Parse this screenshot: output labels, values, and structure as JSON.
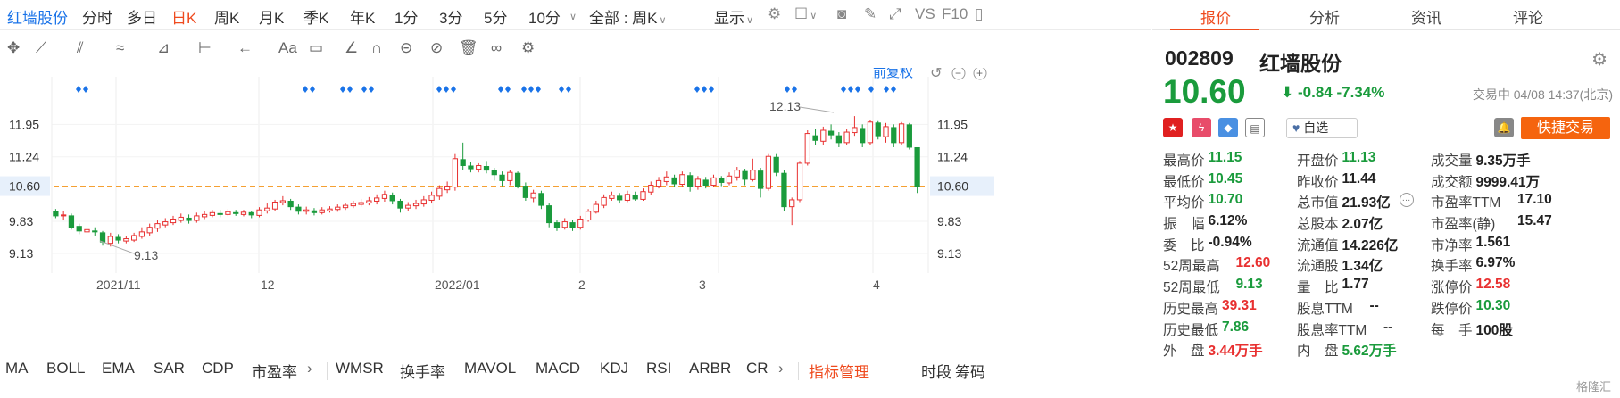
{
  "toolbar": {
    "stock_name": "红墙股份",
    "periods": [
      "分时",
      "多日",
      "日K",
      "周K",
      "月K",
      "季K",
      "年K",
      "1分",
      "3分",
      "5分",
      "10分"
    ],
    "active_period": "日K",
    "range_select": "全部 : 周K",
    "display_label": "显示",
    "vs_label": "VS",
    "f10_label": "F10"
  },
  "chart": {
    "adjust_label": "前复权",
    "high_label": "12.13",
    "low_label": "9.13",
    "y_ticks": [
      "11.95",
      "11.24",
      "10.60",
      "9.83",
      "9.13"
    ],
    "current_price_tag": "10.60",
    "x_labels": [
      "2021/11",
      "12",
      "2022/01",
      "2",
      "3",
      "4"
    ]
  },
  "chart_data": {
    "type": "candlestick",
    "ylim": [
      8.7,
      12.6
    ],
    "reference_line": 10.6,
    "candles": [
      [
        10.05,
        9.95,
        10.1,
        9.9
      ],
      [
        9.95,
        9.97,
        10.05,
        9.85
      ],
      [
        9.95,
        9.7,
        10.0,
        9.65
      ],
      [
        9.72,
        9.62,
        9.78,
        9.55
      ],
      [
        9.6,
        9.65,
        9.75,
        9.5
      ],
      [
        9.62,
        9.6,
        9.7,
        9.52
      ],
      [
        9.58,
        9.38,
        9.62,
        9.3
      ],
      [
        9.35,
        9.5,
        9.58,
        9.28
      ],
      [
        9.48,
        9.42,
        9.55,
        9.35
      ],
      [
        9.4,
        9.45,
        9.5,
        9.35
      ],
      [
        9.42,
        9.52,
        9.58,
        9.38
      ],
      [
        9.5,
        9.6,
        9.7,
        9.45
      ],
      [
        9.58,
        9.7,
        9.78,
        9.52
      ],
      [
        9.68,
        9.78,
        9.85,
        9.6
      ],
      [
        9.75,
        9.82,
        9.9,
        9.7
      ],
      [
        9.8,
        9.88,
        9.95,
        9.75
      ],
      [
        9.85,
        9.92,
        10.0,
        9.8
      ],
      [
        9.9,
        9.85,
        9.98,
        9.78
      ],
      [
        9.85,
        9.95,
        10.02,
        9.8
      ],
      [
        9.93,
        9.98,
        10.05,
        9.88
      ],
      [
        9.96,
        10.02,
        10.08,
        9.92
      ],
      [
        10.0,
        9.98,
        10.08,
        9.92
      ],
      [
        9.98,
        10.04,
        10.1,
        9.94
      ],
      [
        10.02,
        10.0,
        10.08,
        9.95
      ],
      [
        9.98,
        10.03,
        10.08,
        9.94
      ],
      [
        10.02,
        9.97,
        10.06,
        9.9
      ],
      [
        9.96,
        10.08,
        10.14,
        9.92
      ],
      [
        10.06,
        10.12,
        10.22,
        10.0
      ],
      [
        10.1,
        10.25,
        10.3,
        10.05
      ],
      [
        10.24,
        10.28,
        10.38,
        10.18
      ],
      [
        10.27,
        10.15,
        10.32,
        10.08
      ],
      [
        10.14,
        10.05,
        10.2,
        9.98
      ],
      [
        10.05,
        10.08,
        10.15,
        9.98
      ],
      [
        10.06,
        10.02,
        10.12,
        9.96
      ],
      [
        10.02,
        10.08,
        10.14,
        9.98
      ],
      [
        10.06,
        10.1,
        10.16,
        10.02
      ],
      [
        10.09,
        10.14,
        10.2,
        10.04
      ],
      [
        10.13,
        10.18,
        10.24,
        10.08
      ],
      [
        10.17,
        10.22,
        10.28,
        10.12
      ],
      [
        10.2,
        10.24,
        10.32,
        10.15
      ],
      [
        10.23,
        10.28,
        10.36,
        10.18
      ],
      [
        10.27,
        10.34,
        10.42,
        10.2
      ],
      [
        10.33,
        10.42,
        10.5,
        10.26
      ],
      [
        10.4,
        10.28,
        10.46,
        10.2
      ],
      [
        10.27,
        10.12,
        10.32,
        10.02
      ],
      [
        10.12,
        10.18,
        10.25,
        10.05
      ],
      [
        10.17,
        10.22,
        10.3,
        10.1
      ],
      [
        10.21,
        10.3,
        10.38,
        10.15
      ],
      [
        10.29,
        10.4,
        10.48,
        10.22
      ],
      [
        10.38,
        10.55,
        10.62,
        10.3
      ],
      [
        10.52,
        10.6,
        10.7,
        10.45
      ],
      [
        10.58,
        11.2,
        11.3,
        10.5
      ],
      [
        11.18,
        11.05,
        11.55,
        10.95
      ],
      [
        11.04,
        10.98,
        11.12,
        10.9
      ],
      [
        10.97,
        11.05,
        11.1,
        10.9
      ],
      [
        11.03,
        10.95,
        11.15,
        10.88
      ],
      [
        10.94,
        10.85,
        11.0,
        10.72
      ],
      [
        10.84,
        10.72,
        10.92,
        10.6
      ],
      [
        10.72,
        10.9,
        10.95,
        10.62
      ],
      [
        10.88,
        10.6,
        10.92,
        10.55
      ],
      [
        10.6,
        10.35,
        10.68,
        10.28
      ],
      [
        10.34,
        10.45,
        10.52,
        10.25
      ],
      [
        10.44,
        10.18,
        10.5,
        10.1
      ],
      [
        10.17,
        9.8,
        10.22,
        9.7
      ],
      [
        9.8,
        9.7,
        9.85,
        9.62
      ],
      [
        9.7,
        9.82,
        9.9,
        9.65
      ],
      [
        9.8,
        9.7,
        9.86,
        9.62
      ],
      [
        9.7,
        9.88,
        9.95,
        9.65
      ],
      [
        9.86,
        10.05,
        10.1,
        9.82
      ],
      [
        10.03,
        10.2,
        10.28,
        10.0
      ],
      [
        10.18,
        10.35,
        10.42,
        10.12
      ],
      [
        10.33,
        10.4,
        10.48,
        10.28
      ],
      [
        10.38,
        10.3,
        10.45,
        10.22
      ],
      [
        10.29,
        10.42,
        10.5,
        10.25
      ],
      [
        10.4,
        10.32,
        10.48,
        10.28
      ],
      [
        10.31,
        10.48,
        10.55,
        10.28
      ],
      [
        10.47,
        10.62,
        10.7,
        10.4
      ],
      [
        10.6,
        10.72,
        10.8,
        10.55
      ],
      [
        10.7,
        10.8,
        10.92,
        10.62
      ],
      [
        10.78,
        10.65,
        10.85,
        10.58
      ],
      [
        10.64,
        10.85,
        10.92,
        10.58
      ],
      [
        10.83,
        10.6,
        10.9,
        10.48
      ],
      [
        10.6,
        10.75,
        10.82,
        10.52
      ],
      [
        10.73,
        10.62,
        10.8,
        10.55
      ],
      [
        10.62,
        10.78,
        10.85,
        10.58
      ],
      [
        10.76,
        10.68,
        10.82,
        10.6
      ],
      [
        10.67,
        10.82,
        10.9,
        10.62
      ],
      [
        10.8,
        10.95,
        11.02,
        10.72
      ],
      [
        10.92,
        10.75,
        10.98,
        10.62
      ],
      [
        10.74,
        10.95,
        11.2,
        10.7
      ],
      [
        10.93,
        10.55,
        11.0,
        10.35
      ],
      [
        10.55,
        11.25,
        11.3,
        10.5
      ],
      [
        11.23,
        10.9,
        11.3,
        10.82
      ],
      [
        10.88,
        10.15,
        10.95,
        10.05
      ],
      [
        10.15,
        10.3,
        10.35,
        9.75
      ],
      [
        10.3,
        11.1,
        11.15,
        10.25
      ],
      [
        11.1,
        11.75,
        11.82,
        11.05
      ],
      [
        11.7,
        11.6,
        11.85,
        11.5
      ],
      [
        11.58,
        11.82,
        11.9,
        11.5
      ],
      [
        11.8,
        11.72,
        11.95,
        11.62
      ],
      [
        11.7,
        11.55,
        11.78,
        11.45
      ],
      [
        11.55,
        11.78,
        11.85,
        11.5
      ],
      [
        11.77,
        11.88,
        12.13,
        11.7
      ],
      [
        11.86,
        11.55,
        11.95,
        11.45
      ],
      [
        11.55,
        12.0,
        12.05,
        11.5
      ],
      [
        11.98,
        11.7,
        12.02,
        11.62
      ],
      [
        11.68,
        11.9,
        11.98,
        11.55
      ],
      [
        11.88,
        11.55,
        11.95,
        11.45
      ],
      [
        11.55,
        11.96,
        12.0,
        11.5
      ],
      [
        11.94,
        11.45,
        11.98,
        11.4
      ],
      [
        11.44,
        10.6,
        11.15,
        10.45
      ]
    ]
  },
  "indicators": {
    "items": [
      "MA",
      "BOLL",
      "EMA",
      "SAR",
      "CDP",
      "市盈率",
      "WMSR",
      "换手率",
      "MAVOL",
      "MACD",
      "KDJ",
      "RSI",
      "ARBR",
      "CR"
    ],
    "manage_label": "指标管理",
    "fen_label": "时段",
    "chou_label": "筹码"
  },
  "panel": {
    "tabs": [
      "报价",
      "分析",
      "资讯",
      "评论"
    ],
    "code": "002809",
    "name": "红墙股份",
    "price": "10.60",
    "change": "-0.84",
    "change_pct": "-7.34%",
    "status": "交易中 04/08 14:37(北京)",
    "watch_label": "自选",
    "quick_trade": "快捷交易",
    "stats": [
      [
        {
          "label": "最高价",
          "value": "11.15",
          "c": "green"
        },
        {
          "label": "开盘价",
          "value": "11.13",
          "c": "green"
        },
        {
          "label": "成交量",
          "value": "9.35万手",
          "c": ""
        }
      ],
      [
        {
          "label": "最低价",
          "value": "10.45",
          "c": "green"
        },
        {
          "label": "昨收价",
          "value": "11.44",
          "c": ""
        },
        {
          "label": "成交额",
          "value": "9999.41万",
          "c": ""
        }
      ],
      [
        {
          "label": "平均价",
          "value": "10.70",
          "c": "green"
        },
        {
          "label": "总市值",
          "value": "21.93亿",
          "c": ""
        },
        {
          "label": "市盈率TTM",
          "value": "17.10",
          "c": ""
        }
      ],
      [
        {
          "label": "振　幅",
          "value": "6.12%",
          "c": ""
        },
        {
          "label": "总股本",
          "value": "2.07亿",
          "c": ""
        },
        {
          "label": "市盈率(静)",
          "value": "15.47",
          "c": ""
        }
      ],
      [
        {
          "label": "委　比",
          "value": "-0.94%",
          "c": ""
        },
        {
          "label": "流通值",
          "value": "14.226亿",
          "c": ""
        },
        {
          "label": "市净率",
          "value": "1.561",
          "c": ""
        }
      ],
      [
        {
          "label": "52周最高",
          "value": "12.60",
          "c": "red"
        },
        {
          "label": "流通股",
          "value": "1.34亿",
          "c": ""
        },
        {
          "label": "换手率",
          "value": "6.97%",
          "c": ""
        }
      ],
      [
        {
          "label": "52周最低",
          "value": "9.13",
          "c": "green"
        },
        {
          "label": "量　比",
          "value": "1.77",
          "c": ""
        },
        {
          "label": "涨停价",
          "value": "12.58",
          "c": "red"
        }
      ],
      [
        {
          "label": "历史最高",
          "value": "39.31",
          "c": "red"
        },
        {
          "label": "股息TTM",
          "value": "--",
          "c": ""
        },
        {
          "label": "跌停价",
          "value": "10.30",
          "c": "green"
        }
      ],
      [
        {
          "label": "历史最低",
          "value": "7.86",
          "c": "green"
        },
        {
          "label": "股息率TTM",
          "value": "--",
          "c": ""
        },
        {
          "label": "每　手",
          "value": "100股",
          "c": ""
        }
      ],
      [
        {
          "label": "外　盘",
          "value": "3.44万手",
          "c": "red"
        },
        {
          "label": "内　盘",
          "value": "5.62万手",
          "c": "green"
        },
        {
          "label": "",
          "value": "",
          "c": ""
        }
      ]
    ],
    "watermark": "格隆汇"
  },
  "colors": {
    "up": "#e83030",
    "down": "#1a9b3c",
    "accent": "#ef4b1f",
    "blue": "#1a73e8",
    "ref_line": "#f5a032"
  }
}
